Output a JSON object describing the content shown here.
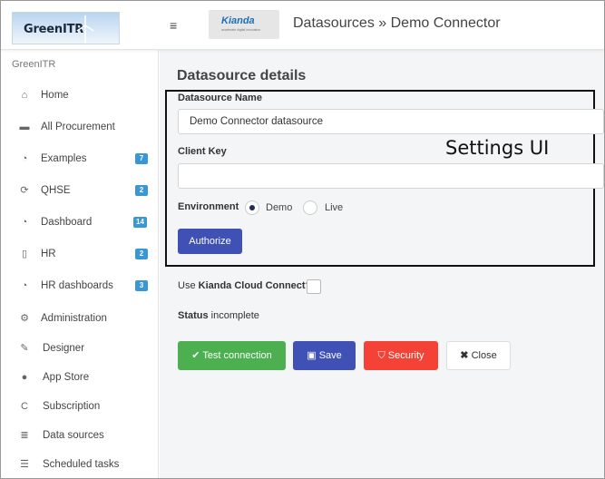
{
  "header": {
    "logo_text": "GreenITR",
    "menu_icon": "hamburger-menu-icon",
    "brand_name": "Kianda",
    "brand_tagline": "accelerate digital innovation",
    "title": "Datasources » Demo Connector"
  },
  "sidebar": {
    "header": "GreenITR",
    "items": [
      {
        "label": "Home",
        "icon": "home-icon",
        "badge": ""
      },
      {
        "label": "All Procurement",
        "icon": "cart-icon",
        "badge": ""
      },
      {
        "label": "Examples",
        "icon": "gauge-icon",
        "badge": "7"
      },
      {
        "label": "QHSE",
        "icon": "refresh-icon",
        "badge": "2"
      },
      {
        "label": "Dashboard",
        "icon": "gauge-icon",
        "badge": "14"
      },
      {
        "label": "HR",
        "icon": "clipboard-icon",
        "badge": "2"
      },
      {
        "label": "HR dashboards",
        "icon": "gauge-icon",
        "badge": "3"
      },
      {
        "label": "Administration",
        "icon": "gear-icon",
        "badge": ""
      },
      {
        "label": "Designer",
        "icon": "edit-icon",
        "badge": ""
      },
      {
        "label": "App Store",
        "icon": "globe-icon",
        "badge": ""
      },
      {
        "label": "Subscription",
        "icon": "copyright-icon",
        "badge": ""
      },
      {
        "label": "Data sources",
        "icon": "database-icon",
        "badge": ""
      },
      {
        "label": "Scheduled tasks",
        "icon": "tasks-icon",
        "badge": ""
      }
    ]
  },
  "main": {
    "section_title": "Datasource details",
    "annotation": "Settings UI",
    "datasource_name": {
      "label": "Datasource Name",
      "value": "Demo Connector datasource"
    },
    "client_key": {
      "label": "Client Key",
      "value": ""
    },
    "environment": {
      "label": "Environment",
      "options": [
        {
          "label": "Demo",
          "checked": true
        },
        {
          "label": "Live",
          "checked": false
        }
      ]
    },
    "authorize_label": "Authorize",
    "cloud_connect": {
      "prefix": "Use ",
      "bold": "Kianda Cloud Connect?",
      "checked": false
    },
    "status": {
      "label": "Status",
      "value": " incomplete"
    },
    "actions": {
      "test_connection": "Test connection",
      "save": "Save",
      "security": "Security",
      "close": "Close"
    }
  },
  "colors": {
    "primary": "#3f51b5",
    "success": "#4caf50",
    "danger": "#f44336",
    "badge": "#3a97d6"
  }
}
